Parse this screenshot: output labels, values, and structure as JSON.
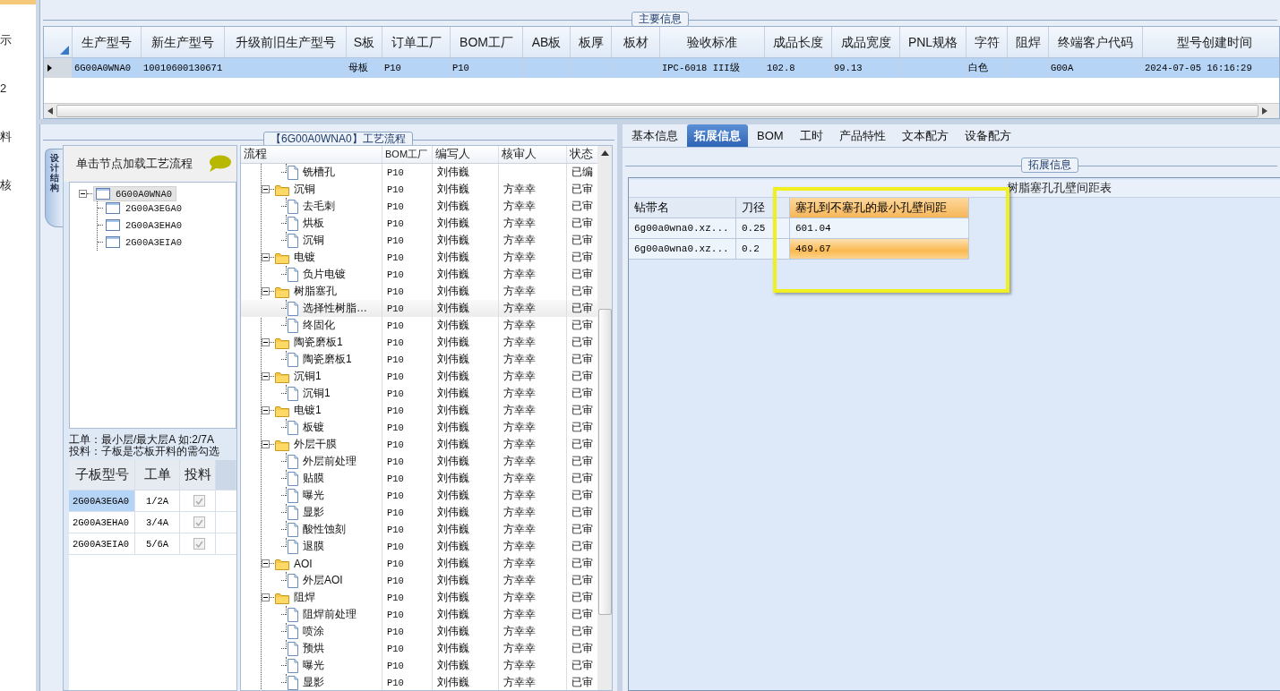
{
  "sidebar": {
    "items": [
      {
        "label": "示"
      },
      {
        "label": "2"
      },
      {
        "label": "料"
      },
      {
        "label": "核"
      }
    ]
  },
  "main_info": {
    "title": "主要信息",
    "columns": [
      "生产型号",
      "新生产型号",
      "升级前旧生产型号",
      "S板",
      "订单工厂",
      "BOM工厂",
      "AB板",
      "板厚",
      "板材",
      "验收标准",
      "成品长度",
      "成品宽度",
      "PNL规格",
      "字符",
      "阻焊",
      "终端客户代码",
      "型号创建时间"
    ],
    "rows": [
      {
        "selected": true,
        "cells": [
          "6G00A0WNA0",
          "10010600130671",
          "",
          "母板",
          "P10",
          "P10",
          "",
          "",
          "",
          "IPC-6018 III级",
          "102.8",
          "99.13",
          "",
          "白色",
          "",
          "G00A",
          "2024-07-05 16:16:29"
        ]
      }
    ]
  },
  "process_flow": {
    "title": "【6G00A0WNA0】工艺流程",
    "structure": {
      "tab": "设计结构",
      "hint": "单击节点加载工艺流程",
      "tree": [
        {
          "label": "6G00A0WNA0",
          "selected": true,
          "expanded": true,
          "children": [
            {
              "label": "2G00A3EGA0",
              "selected": false
            },
            {
              "label": "2G00A3EHA0",
              "selected": false
            },
            {
              "label": "2G00A3EIA0",
              "selected": false
            }
          ]
        }
      ],
      "notes": [
        "工单：最小层/最大层A 如:2/7A",
        "投料：子板是芯板开料的需勾选"
      ],
      "grid": {
        "columns": [
          "子板型号",
          "工单",
          "投料"
        ],
        "rows": [
          {
            "model": "2G00A3EGA0",
            "order": "1/2A",
            "feed": true,
            "disabled": true,
            "selected": true
          },
          {
            "model": "2G00A3EHA0",
            "order": "3/4A",
            "feed": true,
            "disabled": true,
            "selected": false
          },
          {
            "model": "2G00A3EIA0",
            "order": "5/6A",
            "feed": true,
            "disabled": true,
            "selected": false
          }
        ]
      }
    },
    "columns": [
      "流程",
      "BOM工厂",
      "编写人",
      "核审人",
      "状态"
    ],
    "rows": [
      {
        "kind": "file",
        "label": "铣槽孔",
        "bom": "P10",
        "author": "刘伟巍",
        "status": "已编",
        "selected": false
      },
      {
        "kind": "folder",
        "label": "沉铜",
        "bom": "P10",
        "author": "刘伟巍",
        "reviewer": "方幸幸",
        "status": "已审",
        "expanded": true,
        "selected": false,
        "children": [
          {
            "kind": "file",
            "label": "去毛刺",
            "bom": "P10",
            "author": "刘伟巍",
            "reviewer": "方幸幸",
            "status": "已审",
            "selected": false
          },
          {
            "kind": "file",
            "label": "烘板",
            "bom": "P10",
            "author": "刘伟巍",
            "reviewer": "方幸幸",
            "status": "已审",
            "selected": false
          },
          {
            "kind": "file",
            "label": "沉铜",
            "bom": "P10",
            "author": "刘伟巍",
            "reviewer": "方幸幸",
            "status": "已审",
            "selected": false
          }
        ]
      },
      {
        "kind": "folder",
        "label": "电镀",
        "bom": "P10",
        "author": "刘伟巍",
        "reviewer": "方幸幸",
        "status": "已审",
        "expanded": true,
        "selected": false,
        "children": [
          {
            "kind": "file",
            "label": "负片电镀",
            "bom": "P10",
            "author": "刘伟巍",
            "reviewer": "方幸幸",
            "status": "已审",
            "selected": false
          }
        ]
      },
      {
        "kind": "folder",
        "label": "树脂塞孔",
        "bom": "P10",
        "author": "刘伟巍",
        "reviewer": "方幸幸",
        "status": "已审",
        "expanded": true,
        "selected": false,
        "children": [
          {
            "kind": "file",
            "label": "选择性树脂…",
            "bom": "P10",
            "author": "刘伟巍",
            "reviewer": "方幸幸",
            "status": "已审",
            "selected": true
          },
          {
            "kind": "file",
            "label": "终固化",
            "bom": "P10",
            "author": "刘伟巍",
            "reviewer": "方幸幸",
            "status": "已审",
            "selected": false
          }
        ]
      },
      {
        "kind": "folder",
        "label": "陶瓷磨板1",
        "bom": "P10",
        "author": "刘伟巍",
        "reviewer": "方幸幸",
        "status": "已审",
        "expanded": true,
        "selected": false,
        "children": [
          {
            "kind": "file",
            "label": "陶瓷磨板1",
            "bom": "P10",
            "author": "刘伟巍",
            "reviewer": "方幸幸",
            "status": "已审",
            "selected": false
          }
        ]
      },
      {
        "kind": "folder",
        "label": "沉铜1",
        "bom": "P10",
        "author": "刘伟巍",
        "reviewer": "方幸幸",
        "status": "已审",
        "expanded": true,
        "selected": false,
        "children": [
          {
            "kind": "file",
            "label": "沉铜1",
            "bom": "P10",
            "author": "刘伟巍",
            "reviewer": "方幸幸",
            "status": "已审",
            "selected": false
          }
        ]
      },
      {
        "kind": "folder",
        "label": "电镀1",
        "bom": "P10",
        "author": "刘伟巍",
        "reviewer": "方幸幸",
        "status": "已审",
        "expanded": true,
        "selected": false,
        "children": [
          {
            "kind": "file",
            "label": "板镀",
            "bom": "P10",
            "author": "刘伟巍",
            "reviewer": "方幸幸",
            "status": "已审",
            "selected": false
          }
        ]
      },
      {
        "kind": "folder",
        "label": "外层干膜",
        "bom": "P10",
        "author": "刘伟巍",
        "reviewer": "方幸幸",
        "status": "已审",
        "expanded": true,
        "selected": false,
        "children": [
          {
            "kind": "file",
            "label": "外层前处理",
            "bom": "P10",
            "author": "刘伟巍",
            "reviewer": "方幸幸",
            "status": "已审",
            "selected": false
          },
          {
            "kind": "file",
            "label": "贴膜",
            "bom": "P10",
            "author": "刘伟巍",
            "reviewer": "方幸幸",
            "status": "已审",
            "selected": false
          },
          {
            "kind": "file",
            "label": "曝光",
            "bom": "P10",
            "author": "刘伟巍",
            "reviewer": "方幸幸",
            "status": "已审",
            "selected": false
          },
          {
            "kind": "file",
            "label": "显影",
            "bom": "P10",
            "author": "刘伟巍",
            "reviewer": "方幸幸",
            "status": "已审",
            "selected": false
          },
          {
            "kind": "file",
            "label": "酸性蚀刻",
            "bom": "P10",
            "author": "刘伟巍",
            "reviewer": "方幸幸",
            "status": "已审",
            "selected": false
          },
          {
            "kind": "file",
            "label": "退膜",
            "bom": "P10",
            "author": "刘伟巍",
            "reviewer": "方幸幸",
            "status": "已审",
            "selected": false
          }
        ]
      },
      {
        "kind": "folder",
        "label": "AOI",
        "bom": "P10",
        "author": "刘伟巍",
        "reviewer": "方幸幸",
        "status": "已审",
        "expanded": true,
        "selected": false,
        "children": [
          {
            "kind": "file",
            "label": "外层AOI",
            "bom": "P10",
            "author": "刘伟巍",
            "reviewer": "方幸幸",
            "status": "已审",
            "selected": false
          }
        ]
      },
      {
        "kind": "folder",
        "label": "阻焊",
        "bom": "P10",
        "author": "刘伟巍",
        "reviewer": "方幸幸",
        "status": "已审",
        "expanded": true,
        "selected": false,
        "children": [
          {
            "kind": "file",
            "label": "阻焊前处理",
            "bom": "P10",
            "author": "刘伟巍",
            "reviewer": "方幸幸",
            "status": "已审",
            "selected": false
          },
          {
            "kind": "file",
            "label": "喷涂",
            "bom": "P10",
            "author": "刘伟巍",
            "reviewer": "方幸幸",
            "status": "已审",
            "selected": false
          },
          {
            "kind": "file",
            "label": "预烘",
            "bom": "P10",
            "author": "刘伟巍",
            "reviewer": "方幸幸",
            "status": "已审",
            "selected": false
          },
          {
            "kind": "file",
            "label": "曝光",
            "bom": "P10",
            "author": "刘伟巍",
            "reviewer": "方幸幸",
            "status": "已审",
            "selected": false
          },
          {
            "kind": "file",
            "label": "显影",
            "bom": "P10",
            "author": "刘伟巍",
            "reviewer": "方幸幸",
            "status": "已审",
            "selected": false
          }
        ]
      }
    ]
  },
  "detail": {
    "tabs": [
      {
        "label": "基本信息",
        "selected": false
      },
      {
        "label": "拓展信息",
        "selected": true
      },
      {
        "label": "BOM",
        "selected": false
      },
      {
        "label": "工时",
        "selected": false
      },
      {
        "label": "产品特性",
        "selected": false
      },
      {
        "label": "文本配方",
        "selected": false
      },
      {
        "label": "设备配方",
        "selected": false
      }
    ],
    "group_title": "拓展信息",
    "table": {
      "title": "树脂塞孔孔壁间距表",
      "columns": [
        {
          "label": "钻带名",
          "selected": false
        },
        {
          "label": "刀径",
          "selected": false
        },
        {
          "label": "塞孔到不塞孔的最小孔壁间距",
          "selected": true
        }
      ],
      "rows": [
        {
          "selected": false,
          "cells": [
            "6g00a0wna0.xz...",
            "0.25",
            "601.04"
          ]
        },
        {
          "selected": true,
          "cells": [
            "6g00a0wna0.xz...",
            "0.2",
            "469.67"
          ]
        }
      ]
    }
  }
}
